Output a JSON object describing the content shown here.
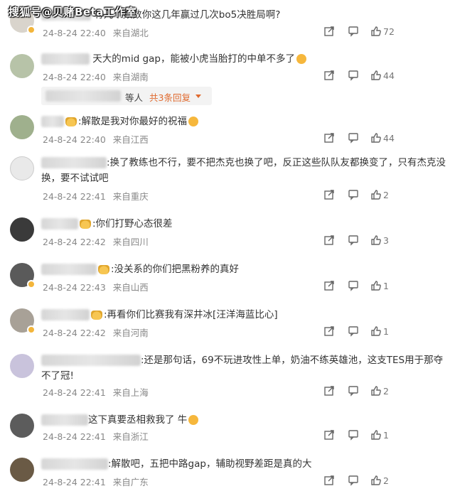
{
  "watermark": "搜狐号@贝赌Beta工作室",
  "comments": [
    {
      "name_blur": true,
      "text": "有几个数数你这几年赢过几次bo5决胜局啊?",
      "date": "24-8-24 22:40",
      "location": "来自湖北",
      "likes": "72"
    },
    {
      "text": "天大的mid gap，能被小虎当胎打的中单不多了",
      "date": "24-8-24 22:40",
      "location": "来自湖南",
      "likes": "44",
      "replies": {
        "who": "等人",
        "more": "共3条回复"
      }
    },
    {
      "text": ":解散是我对你最好的祝福",
      "date": "24-8-24 22:40",
      "location": "来自江西",
      "likes": "44"
    },
    {
      "text": ":换了教练也不行，要不把杰克也换了吧，反正这些队队友都换变了，只有杰克没换，要不试试吧",
      "date": "24-8-24 22:41",
      "location": "来自重庆",
      "likes": "2"
    },
    {
      "text": ":你们打野心态很差",
      "date": "24-8-24 22:42",
      "location": "来自四川",
      "likes": "3"
    },
    {
      "text": ":没关系的你们把黑粉养的真好",
      "date": "24-8-24 22:43",
      "location": "来自山西",
      "likes": "1"
    },
    {
      "text": ":再看你们比赛我有深井冰[汪洋海蓝比心]",
      "date": "24-8-24 22:42",
      "location": "来自河南",
      "likes": "1"
    },
    {
      "text": ":还是那句话，69不玩进攻性上单，奶油不练英雄池，这支TES用于那夺不了冠!",
      "date": "24-8-24 22:41",
      "location": "来自上海",
      "likes": "2"
    },
    {
      "text": "这下真要丞相救我了 牛",
      "date": "24-8-24 22:41",
      "location": "来自浙江",
      "likes": "1"
    },
    {
      "text": ":解散吧，五把中路gap，辅助视野差距是真的大",
      "date": "24-8-24 22:41",
      "location": "来自广东",
      "likes": "2"
    }
  ],
  "icons": {
    "share": "share-icon",
    "comment": "comment-icon",
    "like": "thumbs-up-icon"
  },
  "colors": {
    "link": "#e06a2f",
    "meta": "#888888"
  }
}
